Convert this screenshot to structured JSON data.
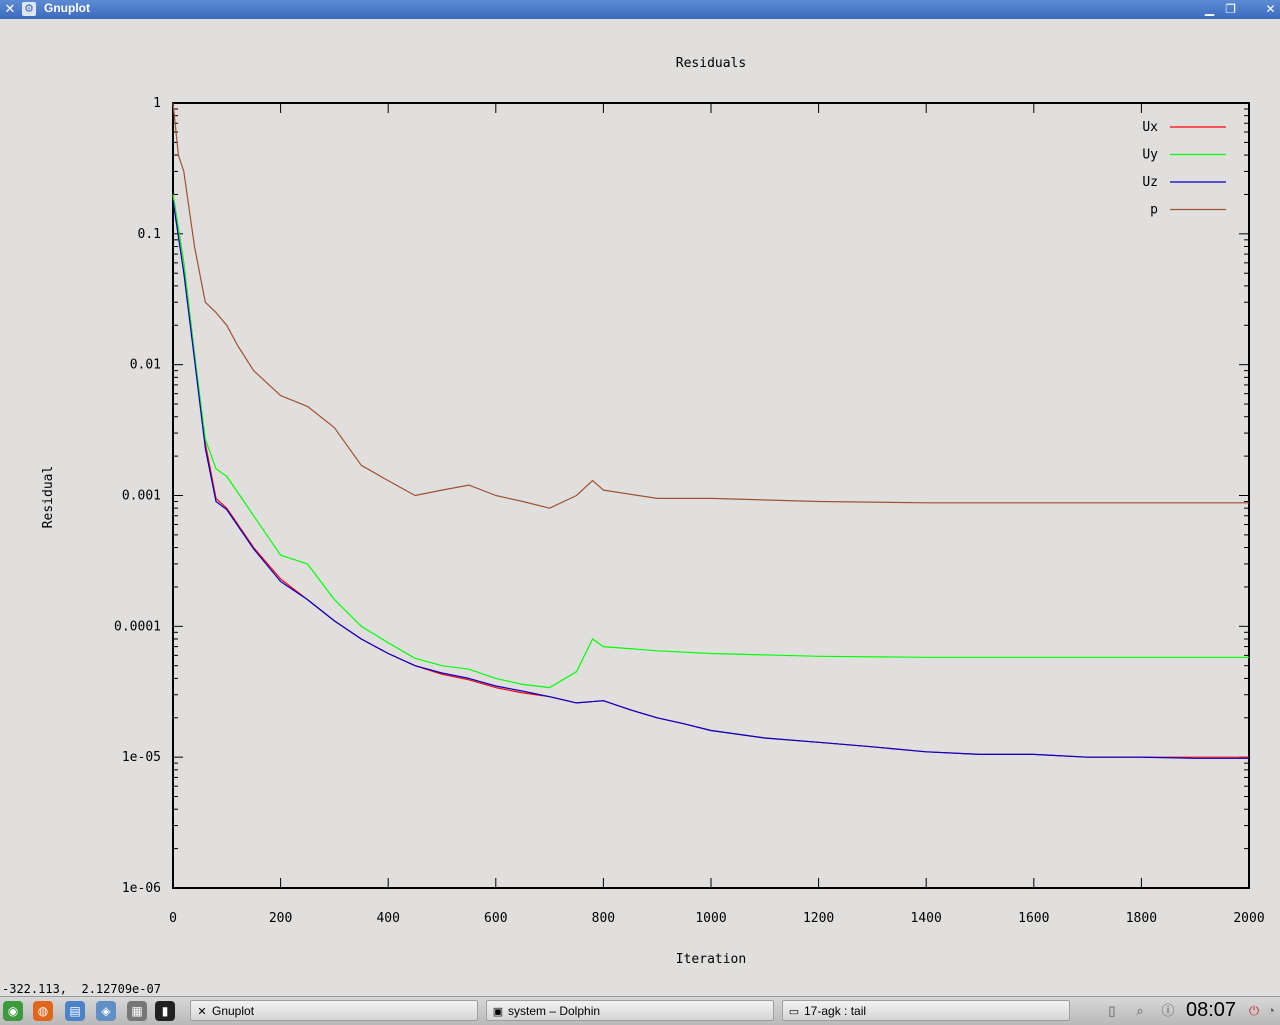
{
  "window": {
    "title": "Gnuplot",
    "app_icon": "gnuplot-icon",
    "menu_icon": "window-menu-icon"
  },
  "status_coords": "-322.113,  2.12709e-07",
  "taskbar": {
    "launchers": [
      "menu-icon",
      "firefox-icon",
      "file-manager-icon",
      "network-icon",
      "calculator-icon",
      "terminal-icon"
    ],
    "tasks": [
      {
        "label": "Gnuplot",
        "icon": "gnuplot-icon"
      },
      {
        "label": "system – Dolphin",
        "icon": "dolphin-icon"
      },
      {
        "label": "17-agk : tail",
        "icon": "terminal-icon"
      }
    ],
    "tray": [
      "clipboard-icon",
      "search-icon",
      "info-icon"
    ],
    "clock": "08:07"
  },
  "chart_data": {
    "type": "line",
    "title": "Residuals",
    "xlabel": "Iteration",
    "ylabel": "Residual",
    "xlim": [
      0,
      2000
    ],
    "ylim": [
      1e-06,
      1
    ],
    "yscale": "log",
    "x_ticks": [
      0,
      200,
      400,
      600,
      800,
      1000,
      1200,
      1400,
      1600,
      1800,
      2000
    ],
    "x_tick_labels": [
      "0",
      "200",
      "400",
      "600",
      "800",
      "1000",
      "1200",
      "1400",
      "1600",
      "1800",
      "2000"
    ],
    "y_ticks": [
      1,
      0.1,
      0.01,
      0.001,
      0.0001,
      1e-05,
      1e-06
    ],
    "y_tick_labels": [
      "1",
      "0.1",
      "0.01",
      "0.001",
      "0.0001",
      "1e-05",
      "1e-06"
    ],
    "legend_position": "top-right",
    "grid": false,
    "series": [
      {
        "name": "Ux",
        "color": "#ff0000",
        "x": [
          0,
          20,
          40,
          60,
          80,
          100,
          150,
          200,
          250,
          300,
          350,
          400,
          450,
          500,
          550,
          600,
          650,
          700,
          750,
          800,
          850,
          900,
          950,
          1000,
          1100,
          1200,
          1300,
          1400,
          1500,
          1600,
          1700,
          1800,
          1900,
          2000
        ],
        "y": [
          0.2,
          0.06,
          0.012,
          0.0025,
          0.00095,
          0.0008,
          0.0004,
          0.00023,
          0.00016,
          0.00011,
          8e-05,
          6.2e-05,
          5e-05,
          4.3e-05,
          3.9e-05,
          3.4e-05,
          3.1e-05,
          2.9e-05,
          2.6e-05,
          2.7e-05,
          2.3e-05,
          2e-05,
          1.8e-05,
          1.6e-05,
          1.4e-05,
          1.3e-05,
          1.2e-05,
          1.1e-05,
          1.05e-05,
          1.05e-05,
          1e-05,
          1e-05,
          1e-05,
          1e-05
        ]
      },
      {
        "name": "Uy",
        "color": "#00ff00",
        "x": [
          0,
          20,
          40,
          60,
          80,
          100,
          150,
          200,
          250,
          300,
          350,
          400,
          450,
          500,
          550,
          600,
          650,
          700,
          750,
          780,
          800,
          900,
          1000,
          1200,
          1400,
          1600,
          1800,
          2000
        ],
        "y": [
          0.2,
          0.06,
          0.012,
          0.0027,
          0.0016,
          0.0014,
          0.0007,
          0.00035,
          0.0003,
          0.00016,
          0.0001,
          7.5e-05,
          5.7e-05,
          5e-05,
          4.7e-05,
          4e-05,
          3.6e-05,
          3.4e-05,
          4.5e-05,
          8e-05,
          7e-05,
          6.5e-05,
          6.2e-05,
          5.9e-05,
          5.8e-05,
          5.8e-05,
          5.8e-05,
          5.8e-05
        ]
      },
      {
        "name": "Uz",
        "color": "#0000cc",
        "x": [
          0,
          20,
          40,
          60,
          80,
          100,
          150,
          200,
          250,
          300,
          350,
          400,
          450,
          500,
          550,
          600,
          650,
          700,
          750,
          800,
          850,
          900,
          950,
          1000,
          1100,
          1200,
          1300,
          1400,
          1500,
          1600,
          1700,
          1800,
          1900,
          2000
        ],
        "y": [
          0.18,
          0.05,
          0.011,
          0.0023,
          0.0009,
          0.00078,
          0.00039,
          0.00022,
          0.00016,
          0.00011,
          8e-05,
          6.2e-05,
          5e-05,
          4.4e-05,
          4e-05,
          3.5e-05,
          3.2e-05,
          2.9e-05,
          2.6e-05,
          2.7e-05,
          2.3e-05,
          2e-05,
          1.8e-05,
          1.6e-05,
          1.4e-05,
          1.3e-05,
          1.2e-05,
          1.1e-05,
          1.05e-05,
          1.05e-05,
          1e-05,
          1e-05,
          9.8e-06,
          9.8e-06
        ]
      },
      {
        "name": "p",
        "color": "#a0522d",
        "x": [
          0,
          10,
          20,
          40,
          60,
          80,
          100,
          120,
          150,
          200,
          250,
          300,
          350,
          400,
          450,
          500,
          550,
          600,
          650,
          700,
          750,
          780,
          800,
          900,
          1000,
          1200,
          1400,
          1600,
          1800,
          2000
        ],
        "y": [
          1,
          0.4,
          0.3,
          0.08,
          0.03,
          0.025,
          0.02,
          0.014,
          0.009,
          0.0058,
          0.0048,
          0.0033,
          0.0017,
          0.0013,
          0.001,
          0.0011,
          0.0012,
          0.001,
          0.0009,
          0.0008,
          0.001,
          0.0013,
          0.0011,
          0.00095,
          0.00095,
          0.0009,
          0.00088,
          0.00088,
          0.00088,
          0.00088
        ]
      }
    ]
  }
}
